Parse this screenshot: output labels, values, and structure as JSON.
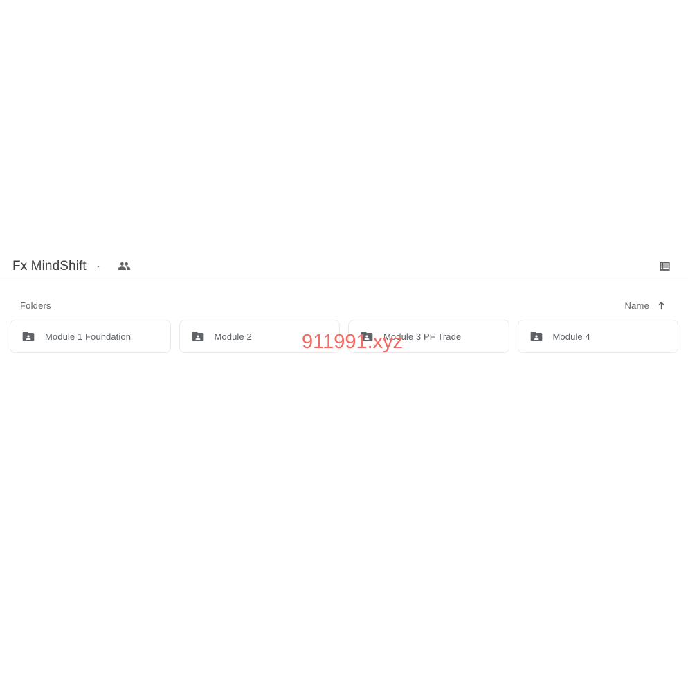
{
  "page": {
    "background": "#ffffff",
    "watermark": {
      "text": "911991.xyz",
      "color": "#ef6b63"
    }
  },
  "header": {
    "title": "Fx MindShift",
    "dropdown_icon": "chevron-down-icon",
    "shared_icon": "people-icon",
    "view_toggle_icon": "list-view-icon",
    "title_color": "#3c4043"
  },
  "section": {
    "label": "Folders",
    "sort": {
      "label": "Name",
      "direction_icon": "arrow-up-icon"
    }
  },
  "folders": [
    {
      "name": "Module 1 Foundation",
      "icon": "shared-folder-icon"
    },
    {
      "name": "Module 2",
      "icon": "shared-folder-icon"
    },
    {
      "name": "Module 3 PF Trade",
      "icon": "shared-folder-icon"
    },
    {
      "name": "Module 4",
      "icon": "shared-folder-icon"
    }
  ]
}
